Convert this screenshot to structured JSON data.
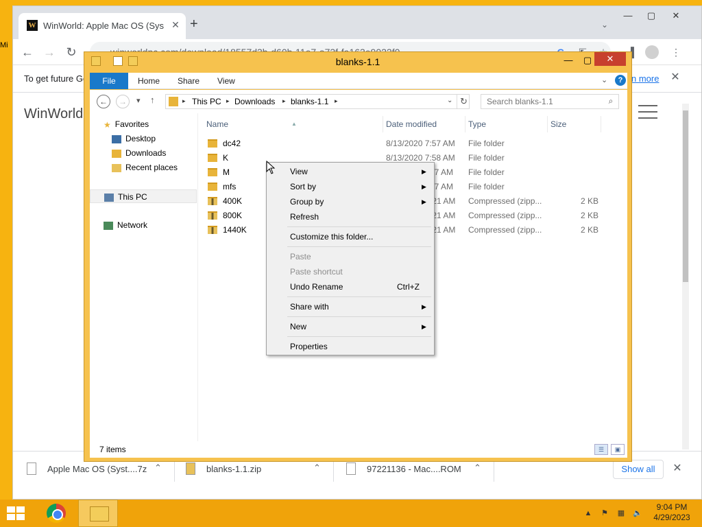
{
  "desktop": {
    "edge_text": "Mi"
  },
  "browser": {
    "tab_title": "WinWorld: Apple Mac OS (System",
    "tab_favicon_letter": "W",
    "url": "winworldpc.com/download/18557d3b-d60b-11e7-a73f-fa163e9022f0",
    "infobar_text": "To get future Go",
    "infobar_link": "n more",
    "site_title": "WinWorld",
    "downloads": [
      {
        "name": "Apple Mac OS (Syst....7z"
      },
      {
        "name": "blanks-1.1.zip"
      },
      {
        "name": "97221136 - Mac....ROM"
      }
    ],
    "show_all": "Show all"
  },
  "explorer": {
    "title": "blanks-1.1",
    "ribbon_tabs": [
      "File",
      "Home",
      "Share",
      "View"
    ],
    "breadcrumb": [
      "This PC",
      "Downloads",
      "blanks-1.1"
    ],
    "search_placeholder": "Search blanks-1.1",
    "nav": {
      "favorites": "Favorites",
      "desktop": "Desktop",
      "downloads": "Downloads",
      "recent": "Recent places",
      "this_pc": "This PC",
      "network": "Network"
    },
    "columns": {
      "name": "Name",
      "date": "Date modified",
      "type": "Type",
      "size": "Size"
    },
    "files": [
      {
        "name": "dc42",
        "date": "8/13/2020 7:57 AM",
        "type": "File folder",
        "size": "",
        "kind": "folder"
      },
      {
        "name": "K",
        "date": "8/13/2020 7:58 AM",
        "type": "File folder",
        "size": "",
        "kind": "folder"
      },
      {
        "name": "M",
        "date": "57 AM",
        "type": "File folder",
        "size": "",
        "kind": "folder"
      },
      {
        "name": "mfs",
        "date": "57 AM",
        "type": "File folder",
        "size": "",
        "kind": "folder"
      },
      {
        "name": "400K",
        "date": ":21 AM",
        "type": "Compressed (zipp...",
        "size": "2 KB",
        "kind": "zip"
      },
      {
        "name": "800K",
        "date": ":21 AM",
        "type": "Compressed (zipp...",
        "size": "2 KB",
        "kind": "zip"
      },
      {
        "name": "1440K",
        "date": ":21 AM",
        "type": "Compressed (zipp...",
        "size": "2 KB",
        "kind": "zip"
      }
    ],
    "status": "7 items"
  },
  "context_menu": {
    "view": "View",
    "sort_by": "Sort by",
    "group_by": "Group by",
    "refresh": "Refresh",
    "customize": "Customize this folder...",
    "paste": "Paste",
    "paste_shortcut": "Paste shortcut",
    "undo_rename": "Undo Rename",
    "undo_shortcut": "Ctrl+Z",
    "share_with": "Share with",
    "new": "New",
    "properties": "Properties"
  },
  "taskbar": {
    "time": "9:04 PM",
    "date": "4/29/2023"
  },
  "colors": {
    "accent": "#f0a30a",
    "file_tab": "#1979ca",
    "close_red": "#c7402e"
  }
}
